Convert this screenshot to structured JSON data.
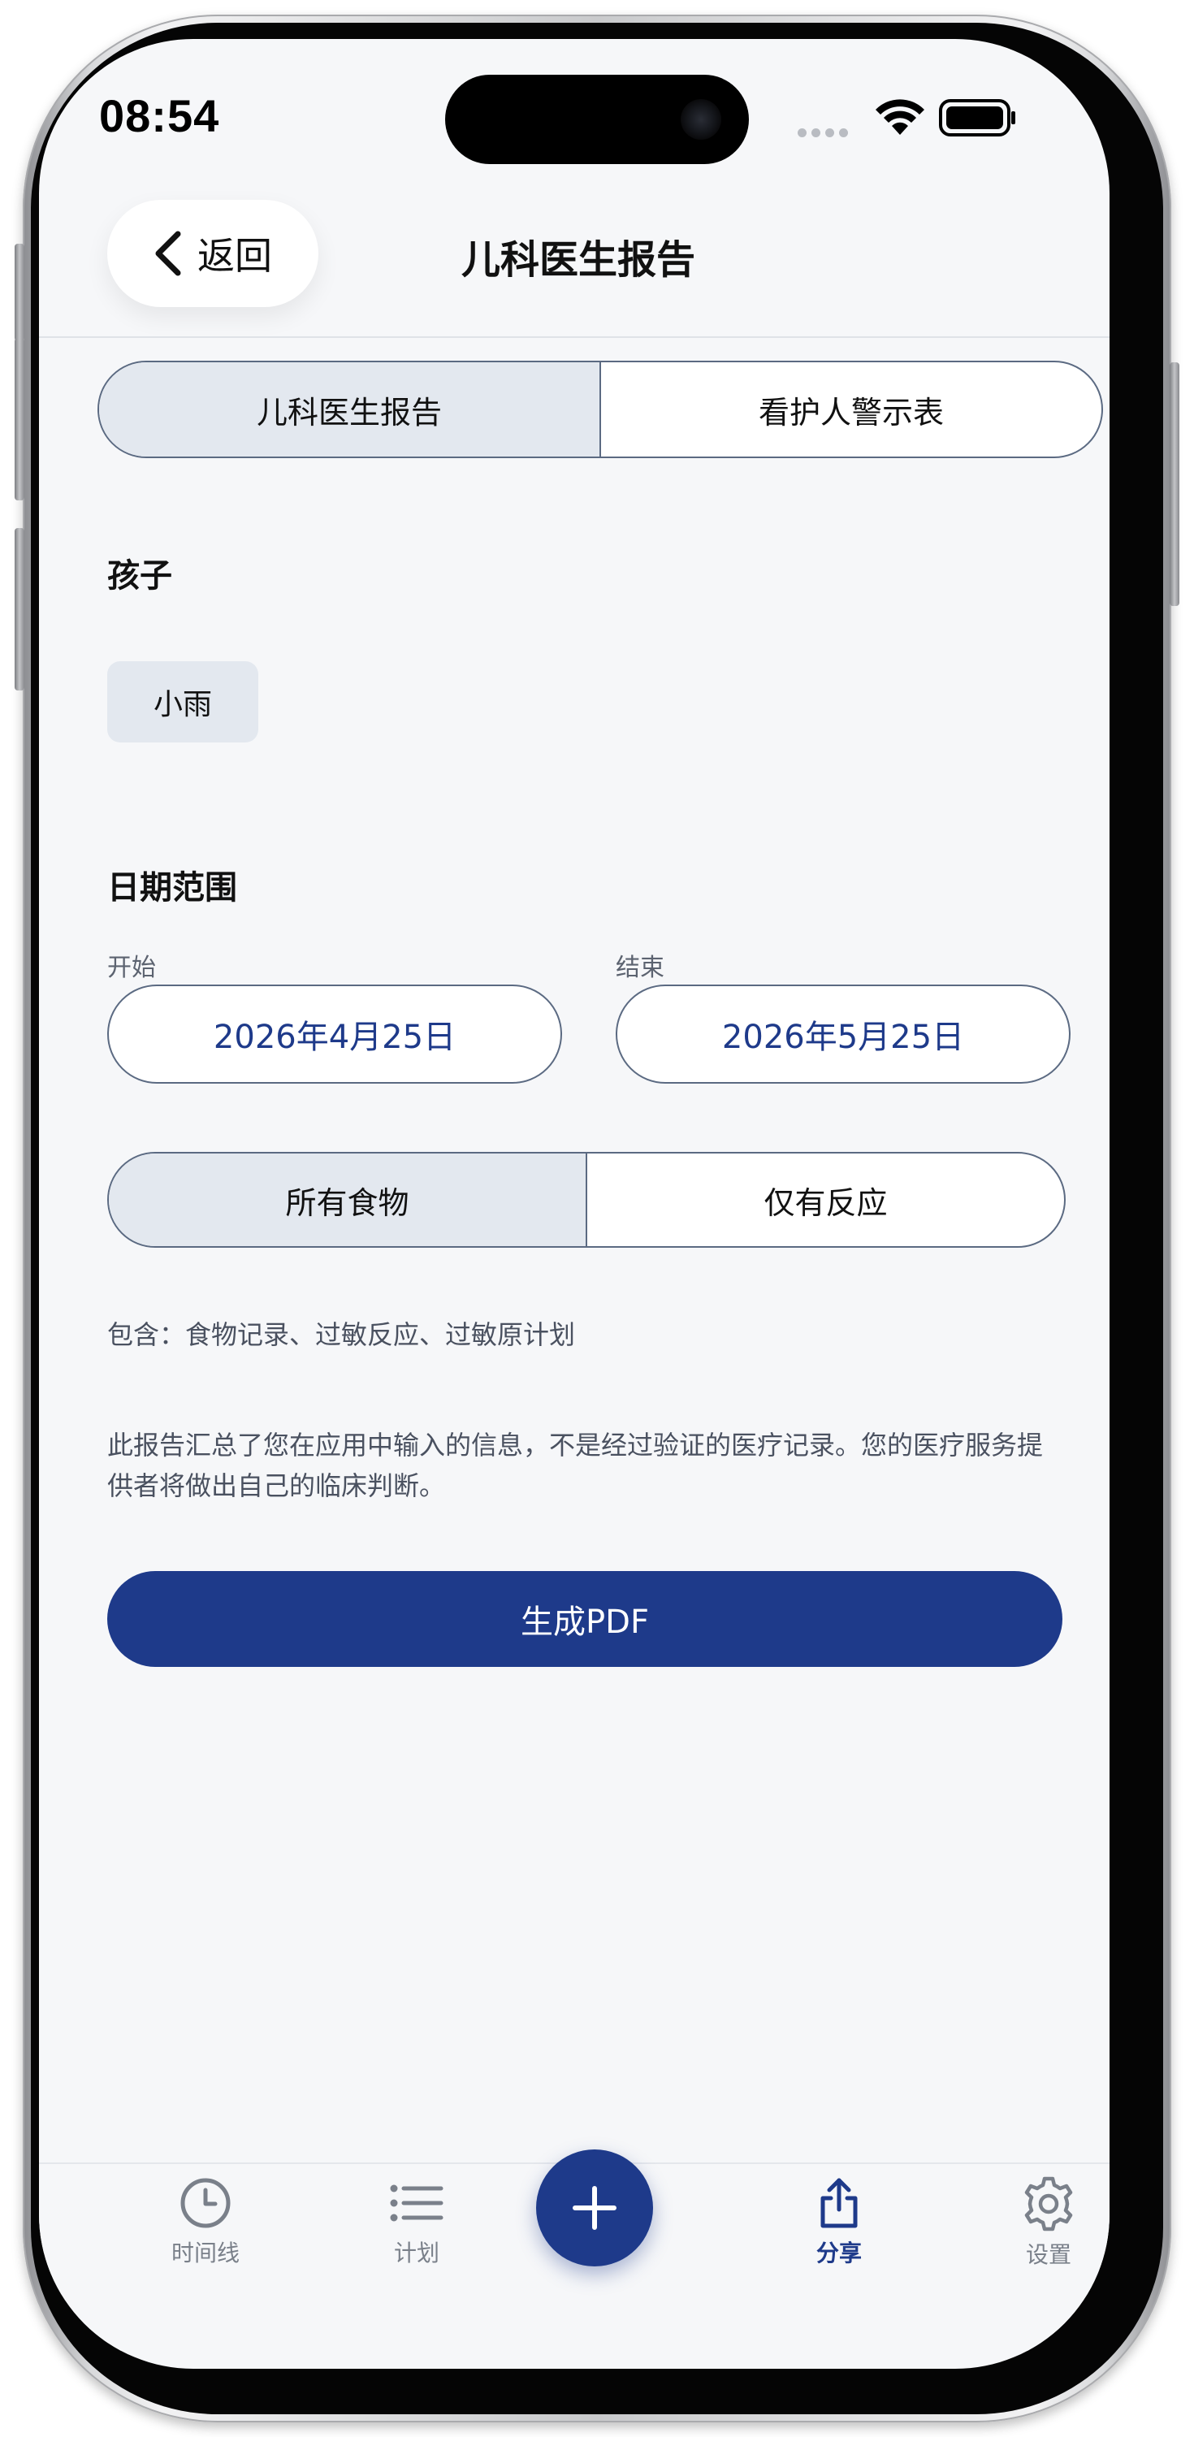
{
  "status_bar": {
    "time": "08:54"
  },
  "nav": {
    "back_label": "返回",
    "title": "儿科医生报告"
  },
  "report_type": {
    "options": [
      "儿科医生报告",
      "看护人警示表"
    ],
    "selected": "儿科医生报告"
  },
  "child": {
    "section_title": "孩子",
    "selected_child": "小雨"
  },
  "date_range": {
    "section_title": "日期范围",
    "start_label": "开始",
    "start_value": "2026年4月25日",
    "end_label": "结束",
    "end_value": "2026年5月25日"
  },
  "filter": {
    "options": [
      "所有食物",
      "仅有反应"
    ],
    "selected": "所有食物"
  },
  "includes_text": "包含：食物记录、过敏反应、过敏原计划",
  "disclaimer": "此报告汇总了您在应用中输入的信息，不是经过验证的医疗记录。您的医疗服务提供者将做出自己的临床判断。",
  "generate_button": "生成PDF",
  "tabbar": {
    "items": [
      {
        "label": "时间线",
        "icon": "clock-icon"
      },
      {
        "label": "计划",
        "icon": "list-icon"
      },
      {
        "label": "分享",
        "icon": "share-icon"
      },
      {
        "label": "设置",
        "icon": "gear-icon"
      }
    ],
    "active": "分享",
    "fab_icon": "plus-icon"
  },
  "colors": {
    "accent": "#1e3a8a",
    "segment_selected": "#e3e8ef",
    "background": "#f6f7f9",
    "border": "#5b6a82"
  }
}
